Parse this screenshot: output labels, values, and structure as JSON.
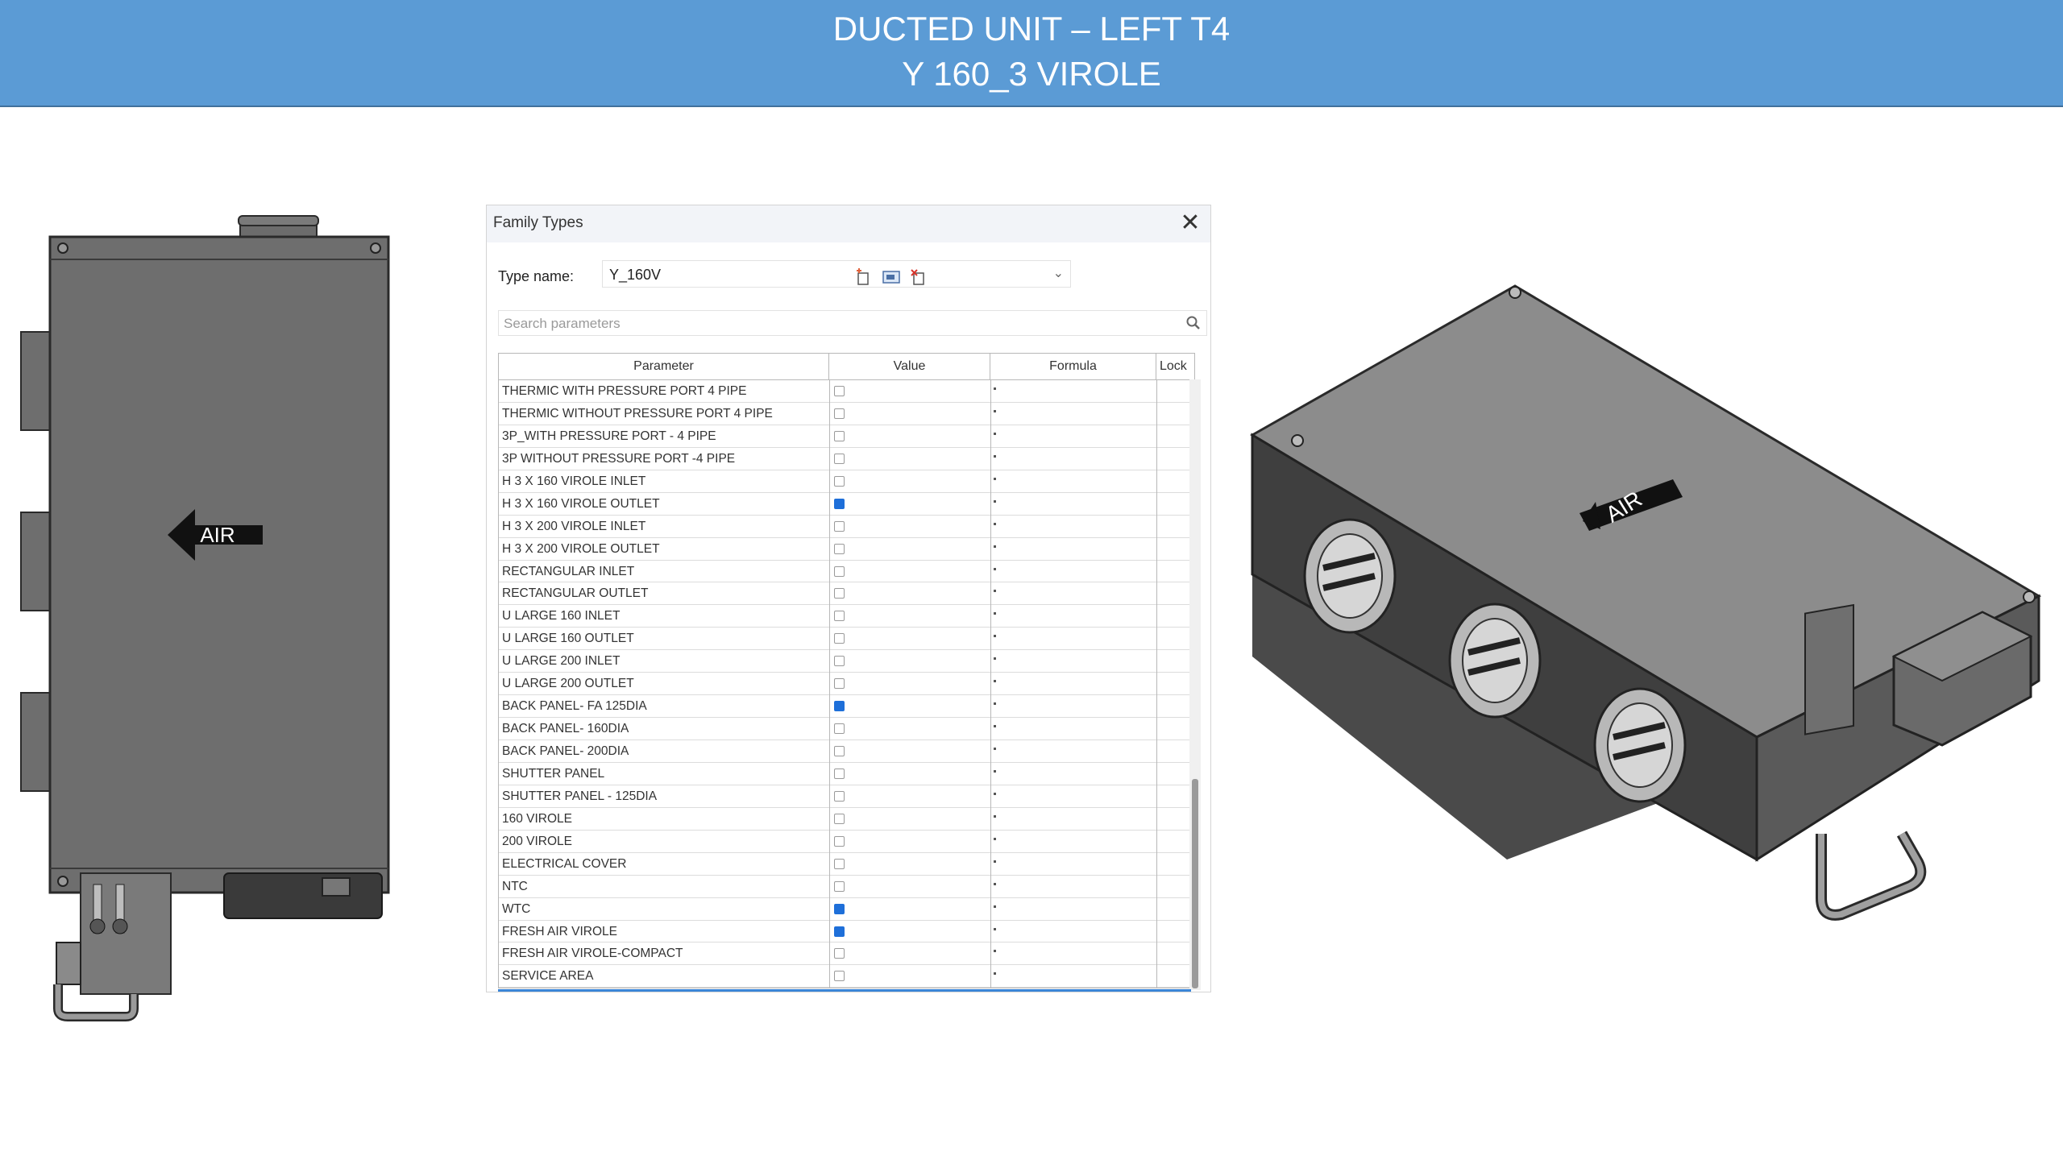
{
  "header": {
    "line1": "DUCTED UNIT – LEFT  T4",
    "line2": "Y 160_3 VIROLE"
  },
  "front_view": {
    "arrow_label": "AIR"
  },
  "iso_view": {
    "arrow_label": "AIR"
  },
  "dialog": {
    "title": "Family Types",
    "type_name_label": "Type name:",
    "type_name_value": "Y_160V",
    "search_placeholder": "Search parameters",
    "columns": {
      "parameter": "Parameter",
      "value": "Value",
      "formula": "Formula",
      "lock": "Lock"
    },
    "formula_mark": "=",
    "rows": [
      {
        "name": "THERMIC WITH PRESSURE PORT 4 PIPE",
        "checked": false
      },
      {
        "name": "THERMIC WITHOUT PRESSURE PORT  4 PIPE",
        "checked": false
      },
      {
        "name": "3P_WITH PRESSURE PORT - 4 PIPE",
        "checked": false
      },
      {
        "name": "3P WITHOUT PRESSURE PORT -4  PIPE",
        "checked": false
      },
      {
        "name": "H  3 X 160 VIROLE INLET",
        "checked": false
      },
      {
        "name": "H  3 X 160 VIROLE OUTLET",
        "checked": true
      },
      {
        "name": "H  3 X 200 VIROLE INLET",
        "checked": false
      },
      {
        "name": "H  3 X 200 VIROLE OUTLET",
        "checked": false
      },
      {
        "name": "RECTANGULAR INLET",
        "checked": false
      },
      {
        "name": "RECTANGULAR OUTLET",
        "checked": false
      },
      {
        "name": "U LARGE 160 INLET",
        "checked": false
      },
      {
        "name": "U LARGE 160 OUTLET",
        "checked": false
      },
      {
        "name": "U LARGE 200 INLET",
        "checked": false
      },
      {
        "name": "U LARGE 200 OUTLET",
        "checked": false
      },
      {
        "name": "BACK PANEL- FA 125DIA",
        "checked": true
      },
      {
        "name": "BACK PANEL- 160DIA",
        "checked": false
      },
      {
        "name": "BACK PANEL- 200DIA",
        "checked": false
      },
      {
        "name": "SHUTTER PANEL",
        "checked": false
      },
      {
        "name": "SHUTTER PANEL - 125DIA",
        "checked": false
      },
      {
        "name": "160 VIROLE",
        "checked": false
      },
      {
        "name": "200 VIROLE",
        "checked": false
      },
      {
        "name": "ELECTRICAL COVER",
        "checked": false
      },
      {
        "name": "NTC",
        "checked": false
      },
      {
        "name": "WTC",
        "checked": true
      },
      {
        "name": "FRESH AIR VIROLE",
        "checked": true
      },
      {
        "name": "FRESH AIR VIROLE-COMPACT",
        "checked": false
      },
      {
        "name": "SERVICE AREA",
        "checked": false
      }
    ]
  }
}
